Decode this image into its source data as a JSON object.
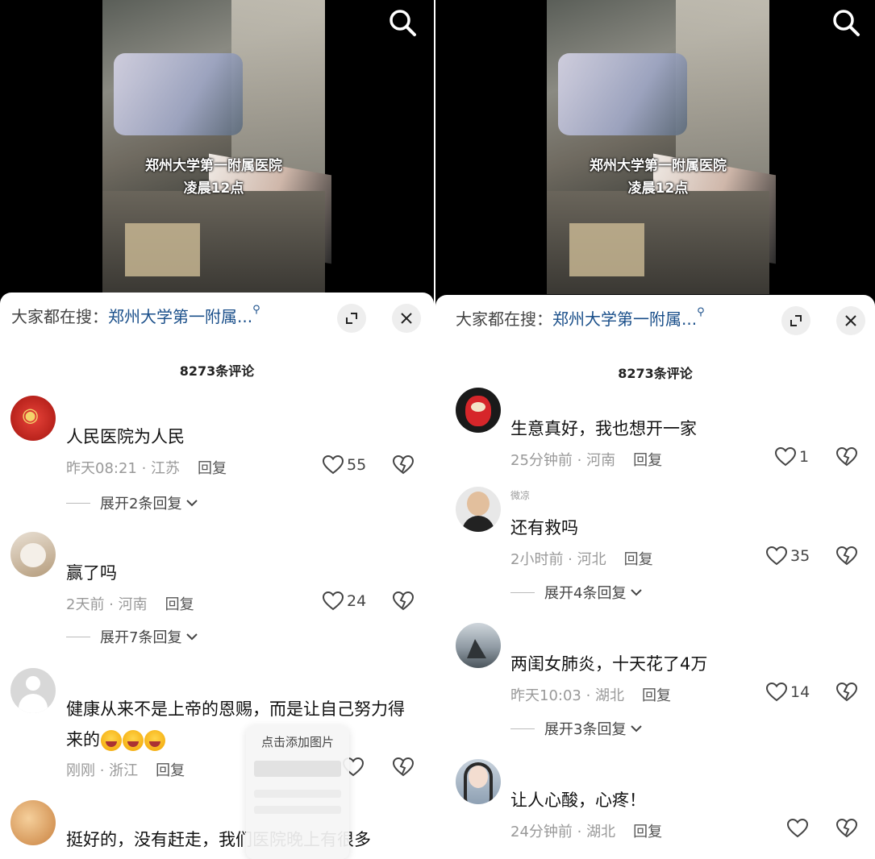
{
  "left": {
    "video": {
      "caption_line1": "郑州大学第一附属医院",
      "caption_line2": "凌晨12点"
    },
    "search_bar": {
      "prefix": "大家都在搜：",
      "query": "郑州大学第一附属..."
    },
    "comment_count": "8273条评论",
    "comments": [
      {
        "text": "人民医院为人民",
        "time": "昨天08:21 · 江苏",
        "reply": "回复",
        "likes": "55",
        "expand": "展开2条回复"
      },
      {
        "text": "赢了吗",
        "time": "2天前 · 河南",
        "reply": "回复",
        "likes": "24",
        "expand": "展开7条回复"
      },
      {
        "text": "健康从来不是上帝的恩赐，而是让自己努力得来的",
        "time": "刚刚 · 浙江",
        "reply": "回复",
        "likes": ""
      },
      {
        "text": "挺好的，没有赶走，我们医院晚上有很多"
      }
    ],
    "popup": {
      "title": "点击添加图片"
    }
  },
  "right": {
    "video": {
      "caption_line1": "郑州大学第一附属医院",
      "caption_line2": "凌晨12点"
    },
    "search_bar": {
      "prefix": "大家都在搜：",
      "query": "郑州大学第一附属..."
    },
    "comment_count": "8273条评论",
    "comments": [
      {
        "text": "生意真好，我也想开一家",
        "time": "25分钟前 · 河南",
        "reply": "回复",
        "likes": "1"
      },
      {
        "name": "微凉",
        "text": "还有救吗",
        "time": "2小时前 · 河北",
        "reply": "回复",
        "likes": "35",
        "expand": "展开4条回复"
      },
      {
        "text": "两闺女肺炎，十天花了4万",
        "time": "昨天10:03 · 湖北",
        "reply": "回复",
        "likes": "14",
        "expand": "展开3条回复"
      },
      {
        "text": "让人心酸，心疼！",
        "time": "24分钟前 · 湖北",
        "reply": "回复",
        "likes": ""
      }
    ]
  },
  "icons": {
    "search": "search-icon",
    "expand": "expand-icon",
    "close": "close-icon",
    "like": "heart-icon",
    "dislike": "broken-heart-icon",
    "chevron": "chevron-down-icon"
  },
  "colors": {
    "link": "#1a4f8a",
    "meta": "#999999",
    "sheet": "#ffffff",
    "video_bg": "#000000"
  }
}
